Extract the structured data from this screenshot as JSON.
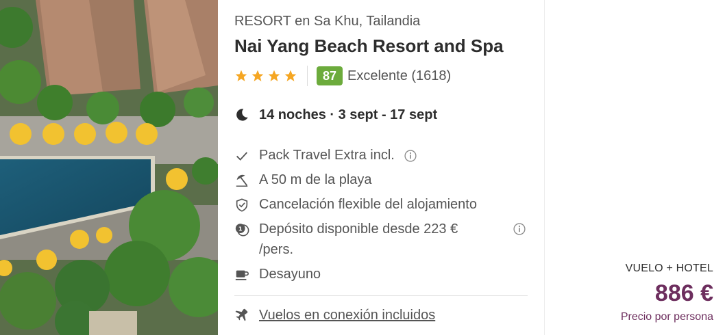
{
  "hotel": {
    "subtitle": "RESORT en Sa Khu, Tailandia",
    "name": "Nai Yang Beach Resort and Spa",
    "stars": 4,
    "score": "87",
    "rating_label": "Excelente (1618)"
  },
  "stay": {
    "summary": "14 noches · 3 sept - 17 sept"
  },
  "features": [
    {
      "icon": "check-icon",
      "text": "Pack Travel Extra incl."
    },
    {
      "icon": "beach-umbrella-icon",
      "text": "A 50 m de la playa"
    },
    {
      "icon": "shield-check-icon",
      "text": "Cancelación flexible del alojamiento"
    },
    {
      "icon": "deposit-coin-icon",
      "text": "Depósito disponible desde 223 € /pers."
    },
    {
      "icon": "coffee-cup-icon",
      "text": "Desayuno"
    }
  ],
  "flights": {
    "icon": "airplane-icon",
    "link_text": "Vuelos en conexión incluidos"
  },
  "price": {
    "package_label": "VUELO + HOTEL",
    "amount": "886 €",
    "note": "Precio por persona"
  },
  "colors": {
    "score_badge": "#6cab3c",
    "stars": "#f5a623",
    "price": "#6d2e5e"
  }
}
